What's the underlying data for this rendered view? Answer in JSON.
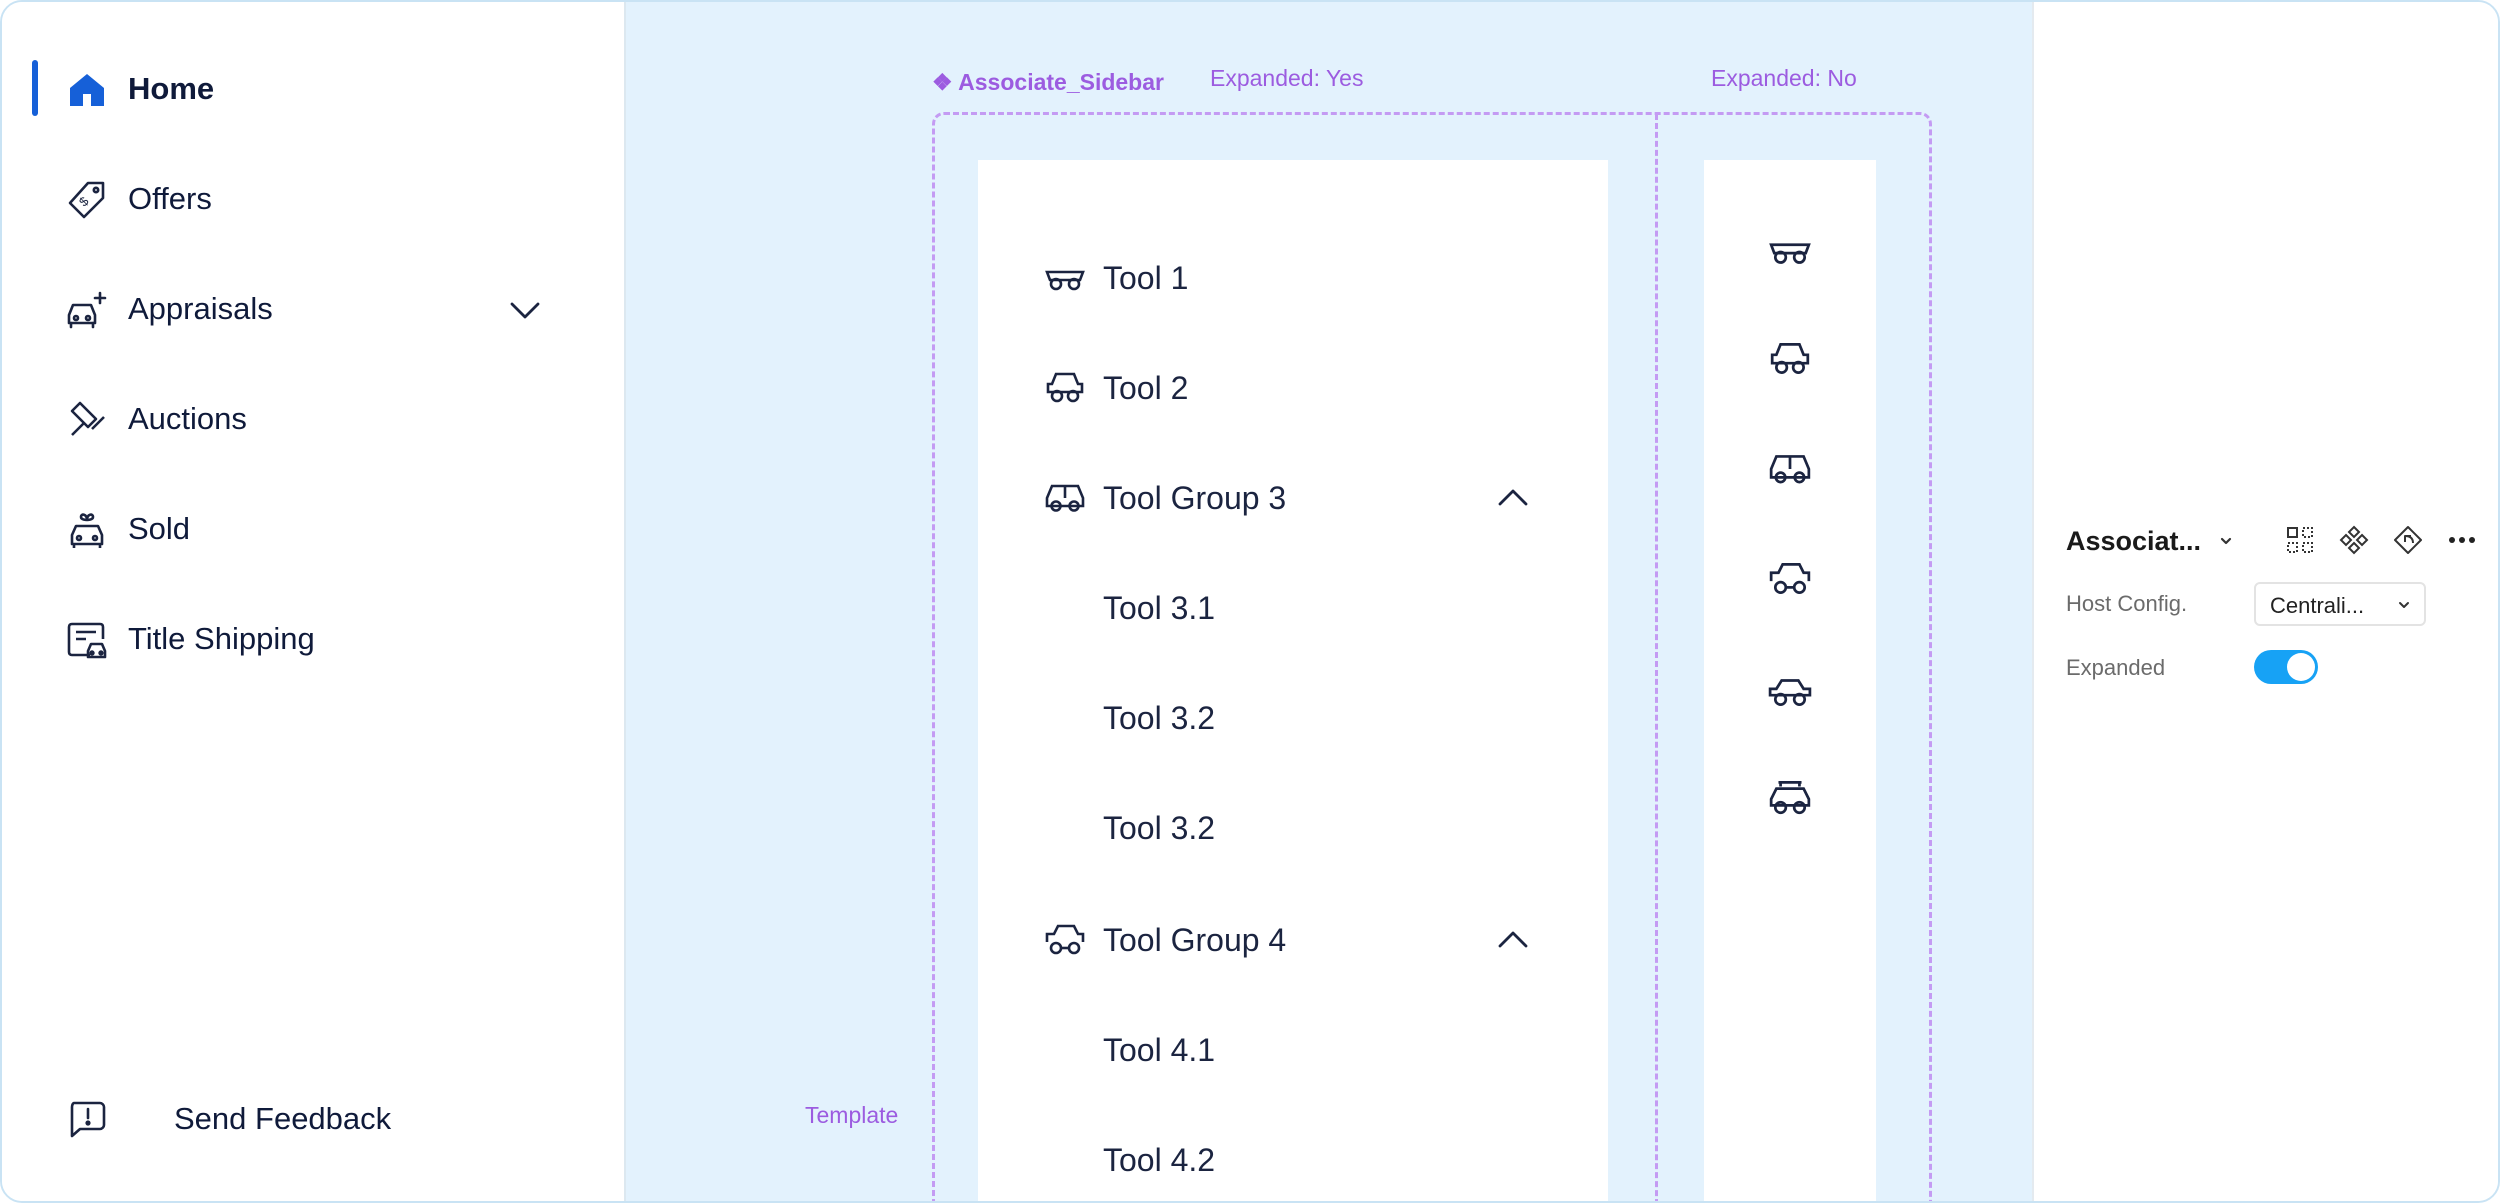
{
  "nav": {
    "items": [
      {
        "label": "Home",
        "icon": "home-icon",
        "active": true
      },
      {
        "label": "Offers",
        "icon": "price-tag-icon"
      },
      {
        "label": "Appraisals",
        "icon": "car-plus-icon",
        "has_chevron": true
      },
      {
        "label": "Auctions",
        "icon": "gavel-icon"
      },
      {
        "label": "Sold",
        "icon": "car-gift-icon"
      },
      {
        "label": "Title Shipping",
        "icon": "title-document-icon"
      }
    ],
    "feedback_label": "Send Feedback",
    "active_color": "#1660d8"
  },
  "canvas": {
    "component_label": "❖ Associate_Sidebar",
    "expanded_yes_label": "Expanded: Yes",
    "expanded_no_label": "Expanded: No",
    "template_label": "Template",
    "accent_color": "#9c5ce0",
    "expanded_rows": [
      {
        "label": "Tool 1",
        "icon": "car-icon-1"
      },
      {
        "label": "Tool 2",
        "icon": "car-icon-2"
      },
      {
        "label": "Tool Group 3",
        "icon": "car-icon-3",
        "caret": "chevron-up-icon"
      },
      {
        "label": "Tool 3.1"
      },
      {
        "label": "Tool 3.2"
      },
      {
        "label": "Tool 3.2"
      },
      {
        "label": "Tool Group 4",
        "icon": "car-icon-4",
        "caret": "chevron-up-icon"
      },
      {
        "label": "Tool 4.1"
      },
      {
        "label": "Tool 4.2"
      }
    ],
    "collapsed_icons": [
      "car-icon-1",
      "car-icon-2",
      "car-icon-3",
      "car-icon-4",
      "car-icon-5",
      "car-icon-6"
    ]
  },
  "props": {
    "title": "Associat...",
    "host_config_label": "Host Config.",
    "host_config_value": "Centrali...",
    "expanded_label": "Expanded",
    "expanded_on": true,
    "toggle_color": "#17a2f5"
  }
}
